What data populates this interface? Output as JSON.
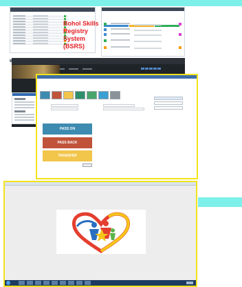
{
  "headline": {
    "lines": [
      "Bohol Skills",
      "Registry",
      "System (BSRS)"
    ],
    "color": "#e31e24"
  },
  "transaction_window": {
    "actions": {
      "pass_on": "PASS ON",
      "pass_back": "PASS BACK",
      "transfer": "TRANSFER"
    },
    "colors": {
      "pass_on": "#3d8bb0",
      "pass_back": "#c0533a",
      "transfer": "#f2c54b",
      "border": "#f2e31b"
    }
  },
  "logo_window": {
    "logo_icon": "heart-people-logo"
  }
}
